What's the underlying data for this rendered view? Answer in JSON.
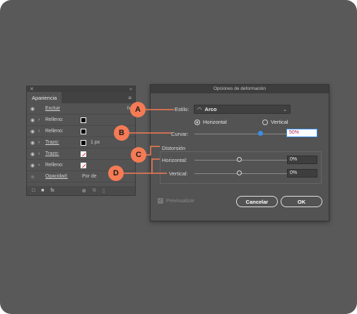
{
  "panel": {
    "tab_label": "Apariencia",
    "close_glyph": "✕",
    "collapse_glyph": "»",
    "menu_glyph": "≡",
    "rows": [
      {
        "label": "Excluir",
        "extra": ""
      },
      {
        "label": "Relleno:",
        "extra": ""
      },
      {
        "label": "Relleno:",
        "extra": ""
      },
      {
        "label": "Trazo:",
        "extra": "1 px"
      },
      {
        "label": "Trazo:",
        "extra": ""
      },
      {
        "label": "Relleno:",
        "extra": ""
      },
      {
        "label": "Opacidad:",
        "extra": "Por de"
      }
    ],
    "fx_label": "fx"
  },
  "dialog": {
    "title": "Opciones de deformación",
    "style_label": "Estilo:",
    "style_value": "Arco",
    "horizontal_label": "Horizontal",
    "vertical_label": "Vertical",
    "orientation_selected": "Horizontal",
    "bend_label": "Curvar:",
    "bend_value": "50%",
    "distortion_label": "Distorsión",
    "dist_horizontal_label": "Horizontal:",
    "dist_horizontal_value": "0%",
    "dist_vertical_label": "Vertical:",
    "dist_vertical_value": "0%",
    "preview_label": "Previsualizar",
    "cancel_label": "Cancelar",
    "ok_label": "OK"
  },
  "callouts": {
    "a": "A",
    "b": "B",
    "c": "C",
    "d": "D"
  },
  "colors": {
    "accent": "#f47b55",
    "slider_blue": "#3a8fe8",
    "background": "#595959"
  }
}
